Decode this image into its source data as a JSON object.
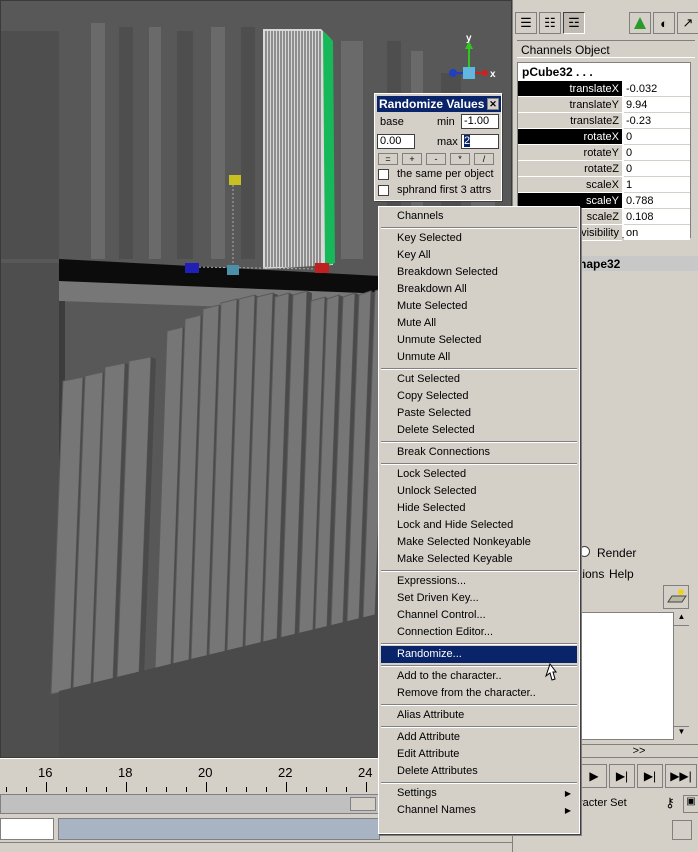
{
  "colors": {
    "viewport_bg": "#5e5e5e",
    "selection_highlight": "#0a246a",
    "channel_selected": "#000000",
    "panel_bg": "#d4d0c8",
    "manipulator_green": "#17b85a",
    "manipulator_red": "#c02020",
    "manipulator_blue": "#2020b8",
    "manipulator_yellow": "#c8c020",
    "axis_y": "#2ec820",
    "axis_x": "#d02020"
  },
  "viewport": {
    "axis_labels": {
      "y": "y",
      "x": "x"
    }
  },
  "timeline": {
    "labels": [
      "16",
      "18",
      "20",
      "22",
      "24"
    ]
  },
  "right_panel": {
    "toolbar_icons": [
      "channel-box-icon",
      "layer-editor-icon",
      "attribute-icon",
      "move-icon",
      "render-icon",
      "arrow-icon"
    ],
    "menu": {
      "channels": "Channels",
      "object": "Object"
    },
    "object_name": "pCube32 . . .",
    "channels": [
      {
        "name": "translateX",
        "value": "-0.032",
        "selected": true
      },
      {
        "name": "translateY",
        "value": "9.94",
        "selected": false
      },
      {
        "name": "translateZ",
        "value": "-0.23",
        "selected": false
      },
      {
        "name": "rotateX",
        "value": "0",
        "selected": true
      },
      {
        "name": "rotateY",
        "value": "0",
        "selected": false
      },
      {
        "name": "rotateZ",
        "value": "0",
        "selected": false
      },
      {
        "name": "scaleX",
        "value": "1",
        "selected": false
      },
      {
        "name": "scaleY",
        "value": "0.788",
        "selected": true
      },
      {
        "name": "scaleZ",
        "value": "0.108",
        "selected": false
      },
      {
        "name": "visibility",
        "value": "on",
        "selected": false
      }
    ],
    "shapes_label": "hape32",
    "layer_editor": {
      "render_label": "Render",
      "options_menu": "tions",
      "help_menu": "Help",
      "chevrons": ">>"
    },
    "character_set_label": "racter Set"
  },
  "randomize_dialog": {
    "title": "Randomize Values",
    "base_label": "base",
    "base_value": "0.00",
    "min_label": "min",
    "min_value": "-1.00",
    "max_label": "max",
    "max_value": "2",
    "operators": [
      "=",
      "+",
      "-",
      "*",
      "/"
    ],
    "checkbox_same": "the same per object",
    "checkbox_sphrand": "sphrand first 3 attrs"
  },
  "context_menu": {
    "groups": [
      [
        "Channels"
      ],
      [
        "Key Selected",
        "Key All",
        "Breakdown Selected",
        "Breakdown All",
        "Mute Selected",
        "Mute All",
        "Unmute Selected",
        "Unmute All"
      ],
      [
        "Cut Selected",
        "Copy Selected",
        "Paste Selected",
        "Delete Selected"
      ],
      [
        "Break Connections"
      ],
      [
        "Lock Selected",
        "Unlock Selected",
        "Hide Selected",
        "Lock and Hide Selected",
        "Make Selected Nonkeyable",
        "Make Selected Keyable"
      ],
      [
        "Expressions...",
        "Set Driven Key...",
        "Channel Control...",
        "Connection Editor..."
      ],
      [
        "Randomize..."
      ],
      [
        "Add to the character..",
        "Remove from the character.."
      ],
      [
        "Alias Attribute"
      ],
      [
        "Add Attribute",
        "Edit Attribute",
        "Delete Attributes"
      ],
      [
        "Settings",
        "Channel Names"
      ]
    ],
    "highlighted": "Randomize...",
    "submenus": [
      "Settings",
      "Channel Names"
    ]
  }
}
